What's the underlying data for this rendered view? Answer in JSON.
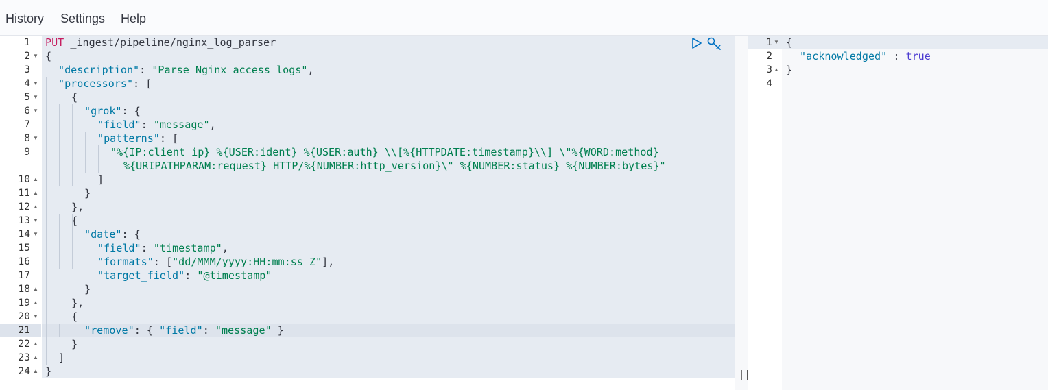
{
  "menu": {
    "history": "History",
    "settings": "Settings",
    "help": "Help"
  },
  "request_editor": {
    "method": "PUT",
    "path": " _ingest/pipeline/nginx_log_parser",
    "line_numbers": [
      "1",
      "2",
      "3",
      "4",
      "5",
      "6",
      "7",
      "8",
      "9",
      "10",
      "11",
      "12",
      "13",
      "14",
      "15",
      "16",
      "17",
      "18",
      "19",
      "20",
      "21",
      "22",
      "23",
      "24"
    ],
    "lines": {
      "l2": "{",
      "l3_key": "\"description\"",
      "l3_val": "\"Parse Nginx access logs\"",
      "l4_key": "\"processors\"",
      "l4_rest": ": [",
      "l5": "{",
      "l6_key": "\"grok\"",
      "l6_rest": ": {",
      "l7_key": "\"field\"",
      "l7_val": "\"message\"",
      "l8_key": "\"patterns\"",
      "l8_rest": ": [",
      "l9a": "\"%{IP:client_ip} %{USER:ident} %{USER:auth} \\\\[%{HTTPDATE:timestamp}\\\\] \\\"%{WORD:method}",
      "l9b": "%{URIPATHPARAM:request} HTTP/%{NUMBER:http_version}\\\" %{NUMBER:status} %{NUMBER:bytes}\"",
      "l10": "]",
      "l11": "}",
      "l12": "},",
      "l13": "{",
      "l14_key": "\"date\"",
      "l14_rest": ": {",
      "l15_key": "\"field\"",
      "l15_val": "\"timestamp\"",
      "l16_key": "\"formats\"",
      "l16_mid": ": [",
      "l16_val": "\"dd/MMM/yyyy:HH:mm:ss Z\"",
      "l16_end": "],",
      "l17_key": "\"target_field\"",
      "l17_val": "\"@timestamp\"",
      "l18": "}",
      "l19": "},",
      "l20": "{",
      "l21_key": "\"remove\"",
      "l21_mid": ": { ",
      "l21_key2": "\"field\"",
      "l21_sep": ": ",
      "l21_val": "\"message\"",
      "l21_end": " }",
      "l22": "}",
      "l23": "]",
      "l24": "}"
    },
    "icons": [
      "play-icon",
      "wrench-icon"
    ]
  },
  "response_viewer": {
    "line_numbers": [
      "1",
      "2",
      "3",
      "4"
    ],
    "l1": "{",
    "l2_key": "\"acknowledged\"",
    "l2_sep": " : ",
    "l2_val": "true",
    "l3": "}"
  },
  "colors": {
    "key": "#0079a5",
    "string": "#007f4f",
    "method": "#c61e60",
    "boolean": "#4c3bd1",
    "request_highlight": "#e6ebf2"
  }
}
